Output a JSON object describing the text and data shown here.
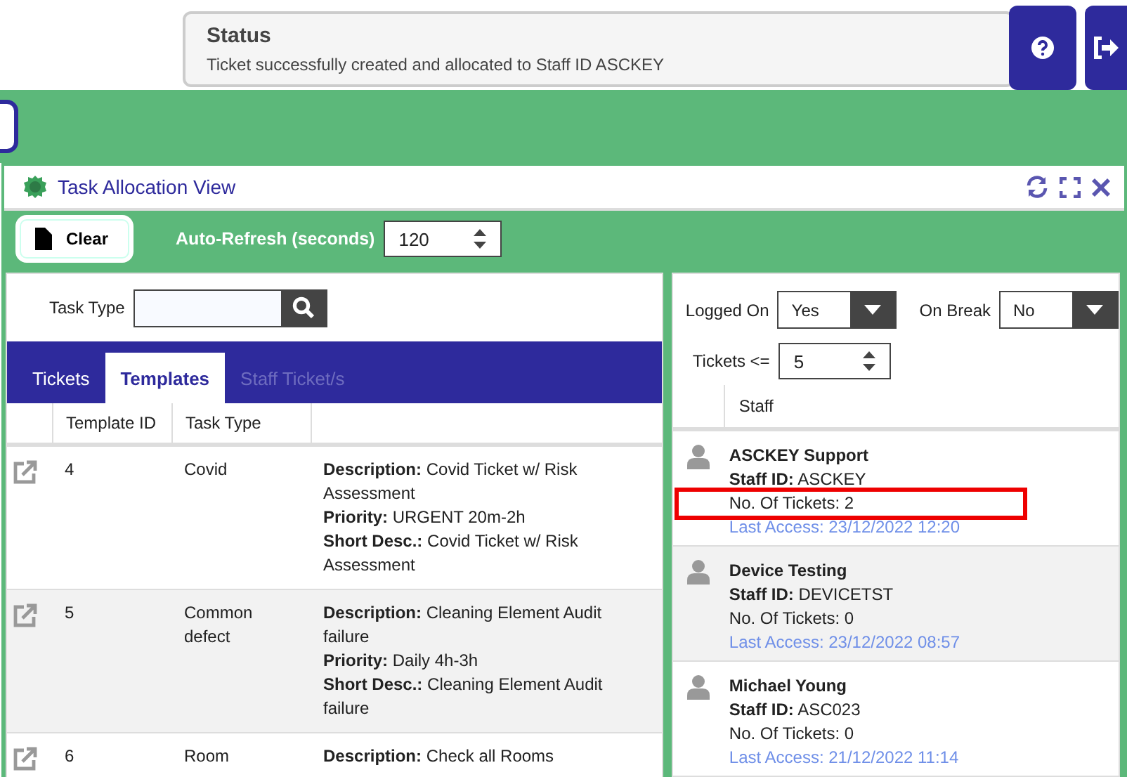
{
  "status": {
    "title": "Status",
    "message": "Ticket successfully created and allocated to Staff ID ASCKEY"
  },
  "panel": {
    "title": "Task Allocation View"
  },
  "toolbar": {
    "clear_label": "Clear",
    "auto_refresh_label": "Auto-Refresh (seconds)",
    "auto_refresh_value": "120"
  },
  "search": {
    "label": "Task Type"
  },
  "tabs": [
    {
      "label": "Tickets",
      "selected": false,
      "disabled": false
    },
    {
      "label": "Templates",
      "selected": true,
      "disabled": false
    },
    {
      "label": "Staff Ticket/s",
      "selected": false,
      "disabled": true
    }
  ],
  "table": {
    "columns": [
      "Template ID",
      "Task Type"
    ],
    "rows": [
      {
        "id": "4",
        "type": "Covid",
        "details": [
          "**Description:** Covid Ticket w/ Risk Assessment",
          "**Priority:** URGENT 20m-2h",
          "**Short Desc.:** Covid Ticket w/ Risk Assessment"
        ]
      },
      {
        "id": "5",
        "type": "Common defect",
        "details": [
          "**Description:** Cleaning Element Audit failure",
          "**Priority:** Daily 4h-3h",
          "**Short Desc.:** Cleaning Element Audit failure"
        ]
      },
      {
        "id": "6",
        "type": "Room",
        "details": [
          "**Description:** Check all Rooms"
        ]
      }
    ]
  },
  "filters": {
    "logged_on_label": "Logged On",
    "logged_on_value": "Yes",
    "on_break_label": "On Break",
    "on_break_value": "No",
    "tickets_label": "Tickets <=",
    "tickets_value": "5"
  },
  "staff": {
    "column": "Staff",
    "items": [
      {
        "name": "ASCKEY Support",
        "staff_id": "**Staff ID:** ASCKEY",
        "tickets": "No. Of Tickets: 2",
        "last_access": "Last Access: 23/12/2022 12:20",
        "highlighted": true
      },
      {
        "name": "Device Testing",
        "staff_id": "**Staff ID:** DEVICETST",
        "tickets": "No. Of Tickets: 0",
        "last_access": "Last Access: 23/12/2022 08:57",
        "highlighted": false
      },
      {
        "name": "Michael Young",
        "staff_id": "**Staff ID:** ASC023",
        "tickets": "No. Of Tickets: 0",
        "last_access": "Last Access: 21/12/2022 11:14",
        "highlighted": false
      }
    ]
  }
}
